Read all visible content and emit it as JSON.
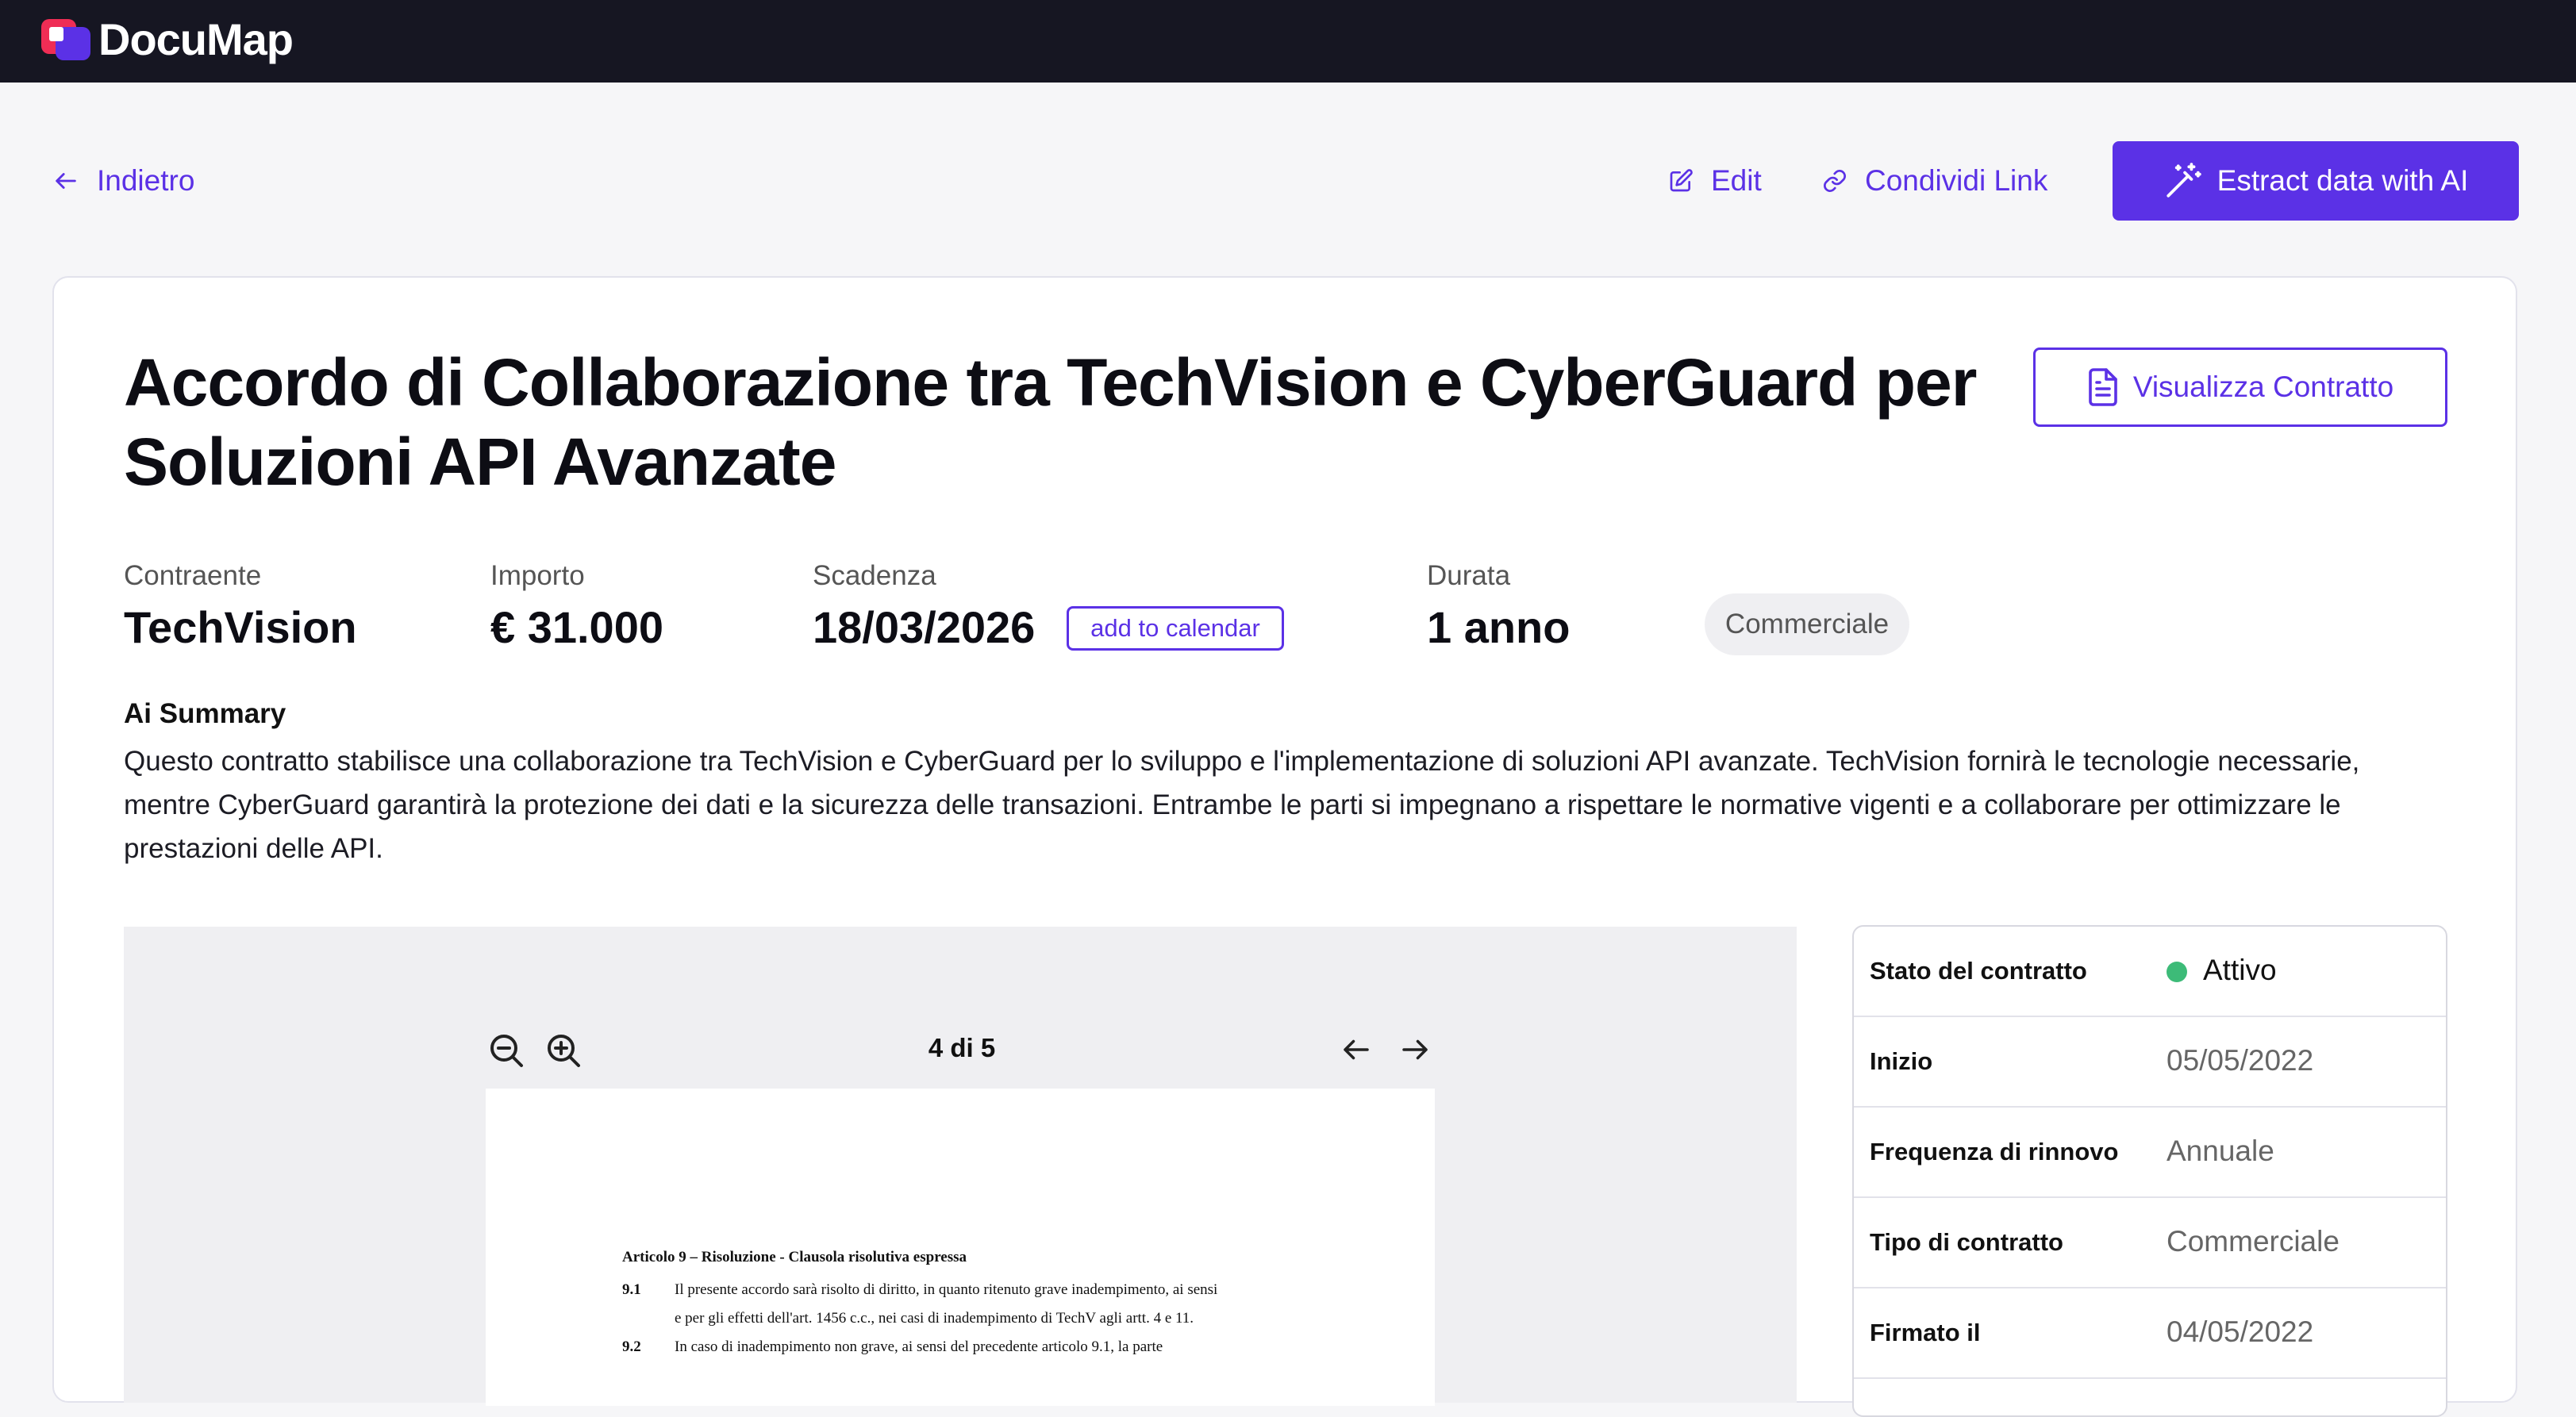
{
  "app": {
    "name": "DocuMap"
  },
  "actions": {
    "back": "Indietro",
    "edit": "Edit",
    "share": "Condividi Link",
    "ai_extract": "Estract data with AI",
    "view_contract": "Visualizza Contratto",
    "add_to_calendar": "add to calendar"
  },
  "contract": {
    "title": "Accordo di Collaborazione tra TechVision e CyberGuard per Soluzioni API Avanzate",
    "meta": {
      "contraente_label": "Contraente",
      "contraente": "TechVision",
      "importo_label": "Importo",
      "importo": "€ 31.000",
      "scadenza_label": "Scadenza",
      "scadenza": "18/03/2026",
      "durata_label": "Durata",
      "durata": "1 anno",
      "tag": "Commerciale"
    },
    "summary_title": "Ai Summary",
    "summary": "Questo contratto stabilisce una collaborazione tra TechVision e CyberGuard per lo sviluppo e l'implementazione di soluzioni API avanzate. TechVision fornirà le tecnologie necessarie, mentre CyberGuard  garantirà la protezione dei dati e la sicurezza delle transazioni. Entrambe le parti si impegnano a rispettare le normative vigenti e a collaborare per ottimizzare le prestazioni delle API."
  },
  "viewer": {
    "page_indicator": "4 di 5",
    "heading": "Articolo 9 – Risoluzione - Clausola risolutiva espressa",
    "clauses": [
      {
        "num": "9.1",
        "text": "Il presente accordo sarà risolto di diritto, in quanto ritenuto grave inadempimento, ai sensi"
      },
      {
        "num": "",
        "text": "e per gli effetti dell'art. 1456 c.c., nei casi di inadempimento di TechV agli artt. 4 e 11."
      },
      {
        "num": "9.2",
        "text": "In caso di inadempimento non grave, ai sensi del precedente articolo 9.1, la parte"
      }
    ]
  },
  "info_table": {
    "status_label": "Stato del contratto",
    "status_value": "Attivo",
    "status_color": "#3dbb78",
    "start_label": "Inizio",
    "start_value": "05/05/2022",
    "renewal_label": "Frequenza di rinnovo",
    "renewal_value": "Annuale",
    "type_label": "Tipo di contratto",
    "type_value": "Commerciale",
    "signed_label": "Firmato il",
    "signed_value": "04/05/2022"
  },
  "icons": [
    "logo-icon",
    "arrow-left-icon",
    "edit-icon",
    "link-icon",
    "magic-wand-icon",
    "document-icon",
    "zoom-out-icon",
    "zoom-in-icon",
    "arrow-right-icon"
  ],
  "colors": {
    "accent": "#5b31e6",
    "topbar": "#161622",
    "background": "#f6f6f8"
  }
}
